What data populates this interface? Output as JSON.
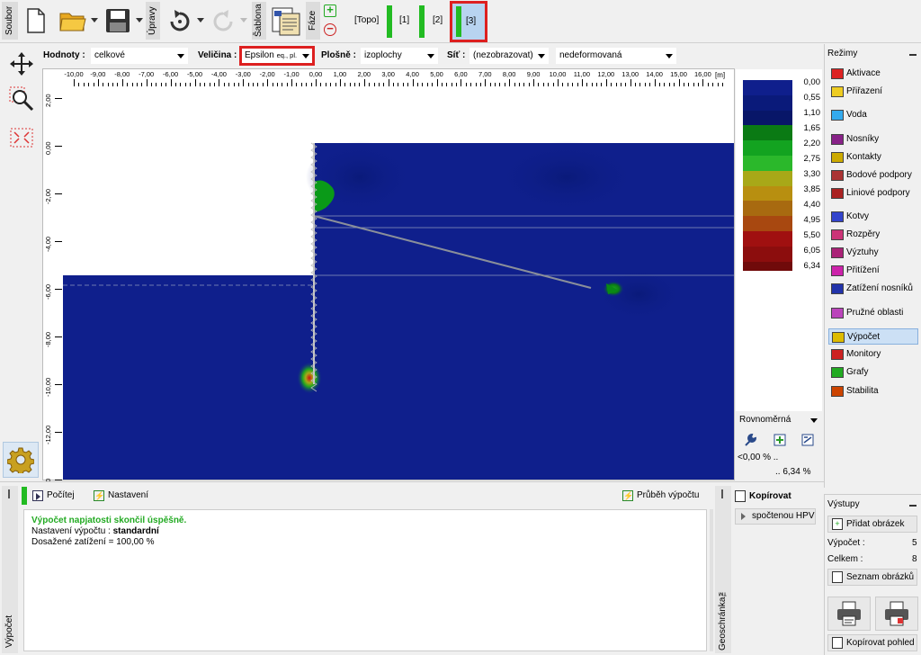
{
  "toolbar": {
    "soubor": "Soubor",
    "upravy": "Úpravy",
    "sablona": "Šablona",
    "faze": "Fáze",
    "stages": [
      "[Topo]",
      "[1]",
      "[2]",
      "[3]"
    ]
  },
  "filters": {
    "hodnoty_label": "Hodnoty :",
    "hodnoty_value": "celkové",
    "velicina_label": "Veličina :",
    "velicina_value": "Epsilon",
    "velicina_sub": "eq., pl.",
    "plosne_label": "Plošně :",
    "plosne_value": "izoplochy",
    "sit_label": "Síť :",
    "sit_value": "(nezobrazovat)",
    "deform_value": "nedeformovaná"
  },
  "ruler": {
    "unit": "[m]",
    "x_ticks": [
      "-10,00",
      "-9,00",
      "-8,00",
      "-7,00",
      "-6,00",
      "-5,00",
      "-4,00",
      "-3,00",
      "-2,00",
      "-1,00",
      "0,00",
      "1,00",
      "2,00",
      "3,00",
      "4,00",
      "5,00",
      "6,00",
      "7,00",
      "8,00",
      "9,00",
      "10,00",
      "11,00",
      "12,00",
      "13,00",
      "14,00",
      "15,00",
      "16,00"
    ],
    "y_ticks": [
      "2,00",
      "0,00",
      "-2,00",
      "-4,00",
      "-6,00",
      "-8,00",
      "-10,00",
      "-12,00",
      "00"
    ]
  },
  "legend": {
    "values": [
      "0,00",
      "0,55",
      "1,10",
      "1,65",
      "2,20",
      "2,75",
      "3,30",
      "3,85",
      "4,40",
      "4,95",
      "5,50",
      "6,05",
      "6,34"
    ],
    "colors": [
      "#0f1f8c",
      "#0a1a7a",
      "#081668",
      "#0a7a14",
      "#13a320",
      "#2bb82b",
      "#a8a818",
      "#b88f10",
      "#a86a10",
      "#a84810",
      "#a01010",
      "#8c0d0d",
      "#700a0a"
    ],
    "scale_mode": "Rovnoměrná",
    "min_label": "<0,00 % ..",
    "max_label": ".. 6,34 %"
  },
  "modes": {
    "title": "Režimy",
    "items": [
      "Aktivace",
      "Přiřazení",
      "Voda",
      "Nosníky",
      "Kontakty",
      "Bodové podpory",
      "Liniové podpory",
      "Kotvy",
      "Rozpěry",
      "Výztuhy",
      "Přitížení",
      "Zatížení nosníků",
      "Pružné oblasti",
      "Výpočet",
      "Monitory",
      "Grafy",
      "Stabilita"
    ],
    "icon_colors": [
      "#dd2222",
      "#eecc22",
      "#33aaee",
      "#882288",
      "#ccaa00",
      "#aa3333",
      "#aa2222",
      "#3344cc",
      "#cc3377",
      "#aa2277",
      "#cc22aa",
      "#2233aa",
      "#bb44bb",
      "#ddbb00",
      "#cc2222",
      "#22aa22",
      "#cc4400"
    ]
  },
  "bottom": {
    "vypocet_tab": "Výpočet",
    "pocitej": "Počítej",
    "nastaveni": "Nastavení",
    "prubeh": "Průběh výpočtu",
    "msg1": "Výpočet napjatosti skončil úspěšně.",
    "msg2_label": "Nastavení výpočtu : ",
    "msg2_value": "standardní",
    "msg3": "Dosažené zatížení = 100,00 %",
    "geoschranka": "Geoschránka™",
    "kopirovat": "Kopírovat",
    "spoctenou": "spočtenou HPV"
  },
  "outputs": {
    "title": "Výstupy",
    "pridat": "Přidat obrázek",
    "vypocet_label": "Výpočet :",
    "vypocet_count": "5",
    "celkem_label": "Celkem :",
    "celkem_count": "8",
    "seznam": "Seznam obrázků",
    "kopirovat_pohled": "Kopírovat pohled"
  }
}
